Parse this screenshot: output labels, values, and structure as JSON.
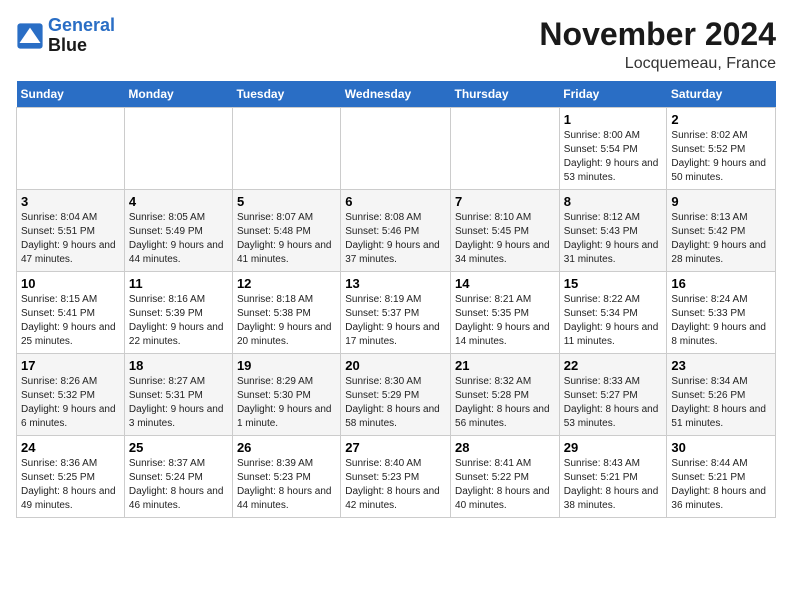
{
  "header": {
    "logo_line1": "General",
    "logo_line2": "Blue",
    "month": "November 2024",
    "location": "Locquemeau, France"
  },
  "weekdays": [
    "Sunday",
    "Monday",
    "Tuesday",
    "Wednesday",
    "Thursday",
    "Friday",
    "Saturday"
  ],
  "weeks": [
    [
      {
        "day": "",
        "info": ""
      },
      {
        "day": "",
        "info": ""
      },
      {
        "day": "",
        "info": ""
      },
      {
        "day": "",
        "info": ""
      },
      {
        "day": "",
        "info": ""
      },
      {
        "day": "1",
        "info": "Sunrise: 8:00 AM\nSunset: 5:54 PM\nDaylight: 9 hours and 53 minutes."
      },
      {
        "day": "2",
        "info": "Sunrise: 8:02 AM\nSunset: 5:52 PM\nDaylight: 9 hours and 50 minutes."
      }
    ],
    [
      {
        "day": "3",
        "info": "Sunrise: 8:04 AM\nSunset: 5:51 PM\nDaylight: 9 hours and 47 minutes."
      },
      {
        "day": "4",
        "info": "Sunrise: 8:05 AM\nSunset: 5:49 PM\nDaylight: 9 hours and 44 minutes."
      },
      {
        "day": "5",
        "info": "Sunrise: 8:07 AM\nSunset: 5:48 PM\nDaylight: 9 hours and 41 minutes."
      },
      {
        "day": "6",
        "info": "Sunrise: 8:08 AM\nSunset: 5:46 PM\nDaylight: 9 hours and 37 minutes."
      },
      {
        "day": "7",
        "info": "Sunrise: 8:10 AM\nSunset: 5:45 PM\nDaylight: 9 hours and 34 minutes."
      },
      {
        "day": "8",
        "info": "Sunrise: 8:12 AM\nSunset: 5:43 PM\nDaylight: 9 hours and 31 minutes."
      },
      {
        "day": "9",
        "info": "Sunrise: 8:13 AM\nSunset: 5:42 PM\nDaylight: 9 hours and 28 minutes."
      }
    ],
    [
      {
        "day": "10",
        "info": "Sunrise: 8:15 AM\nSunset: 5:41 PM\nDaylight: 9 hours and 25 minutes."
      },
      {
        "day": "11",
        "info": "Sunrise: 8:16 AM\nSunset: 5:39 PM\nDaylight: 9 hours and 22 minutes."
      },
      {
        "day": "12",
        "info": "Sunrise: 8:18 AM\nSunset: 5:38 PM\nDaylight: 9 hours and 20 minutes."
      },
      {
        "day": "13",
        "info": "Sunrise: 8:19 AM\nSunset: 5:37 PM\nDaylight: 9 hours and 17 minutes."
      },
      {
        "day": "14",
        "info": "Sunrise: 8:21 AM\nSunset: 5:35 PM\nDaylight: 9 hours and 14 minutes."
      },
      {
        "day": "15",
        "info": "Sunrise: 8:22 AM\nSunset: 5:34 PM\nDaylight: 9 hours and 11 minutes."
      },
      {
        "day": "16",
        "info": "Sunrise: 8:24 AM\nSunset: 5:33 PM\nDaylight: 9 hours and 8 minutes."
      }
    ],
    [
      {
        "day": "17",
        "info": "Sunrise: 8:26 AM\nSunset: 5:32 PM\nDaylight: 9 hours and 6 minutes."
      },
      {
        "day": "18",
        "info": "Sunrise: 8:27 AM\nSunset: 5:31 PM\nDaylight: 9 hours and 3 minutes."
      },
      {
        "day": "19",
        "info": "Sunrise: 8:29 AM\nSunset: 5:30 PM\nDaylight: 9 hours and 1 minute."
      },
      {
        "day": "20",
        "info": "Sunrise: 8:30 AM\nSunset: 5:29 PM\nDaylight: 8 hours and 58 minutes."
      },
      {
        "day": "21",
        "info": "Sunrise: 8:32 AM\nSunset: 5:28 PM\nDaylight: 8 hours and 56 minutes."
      },
      {
        "day": "22",
        "info": "Sunrise: 8:33 AM\nSunset: 5:27 PM\nDaylight: 8 hours and 53 minutes."
      },
      {
        "day": "23",
        "info": "Sunrise: 8:34 AM\nSunset: 5:26 PM\nDaylight: 8 hours and 51 minutes."
      }
    ],
    [
      {
        "day": "24",
        "info": "Sunrise: 8:36 AM\nSunset: 5:25 PM\nDaylight: 8 hours and 49 minutes."
      },
      {
        "day": "25",
        "info": "Sunrise: 8:37 AM\nSunset: 5:24 PM\nDaylight: 8 hours and 46 minutes."
      },
      {
        "day": "26",
        "info": "Sunrise: 8:39 AM\nSunset: 5:23 PM\nDaylight: 8 hours and 44 minutes."
      },
      {
        "day": "27",
        "info": "Sunrise: 8:40 AM\nSunset: 5:23 PM\nDaylight: 8 hours and 42 minutes."
      },
      {
        "day": "28",
        "info": "Sunrise: 8:41 AM\nSunset: 5:22 PM\nDaylight: 8 hours and 40 minutes."
      },
      {
        "day": "29",
        "info": "Sunrise: 8:43 AM\nSunset: 5:21 PM\nDaylight: 8 hours and 38 minutes."
      },
      {
        "day": "30",
        "info": "Sunrise: 8:44 AM\nSunset: 5:21 PM\nDaylight: 8 hours and 36 minutes."
      }
    ]
  ]
}
